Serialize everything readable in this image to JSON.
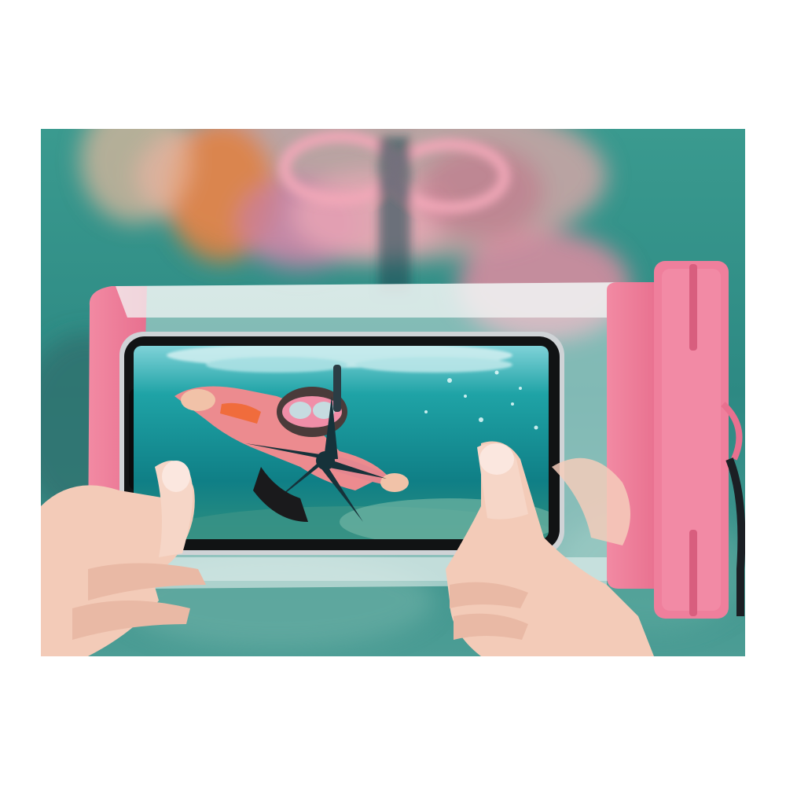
{
  "image": {
    "palette": {
      "water": "#2f8e86",
      "water_deep": "#1e5f63",
      "pouch_pink": "#f07f9a",
      "pouch_pink_dark": "#d85e7e",
      "skin": "#f2c9b8",
      "phone_frame": "#cfd3d6",
      "screen_water": "#1b9aa0"
    }
  }
}
